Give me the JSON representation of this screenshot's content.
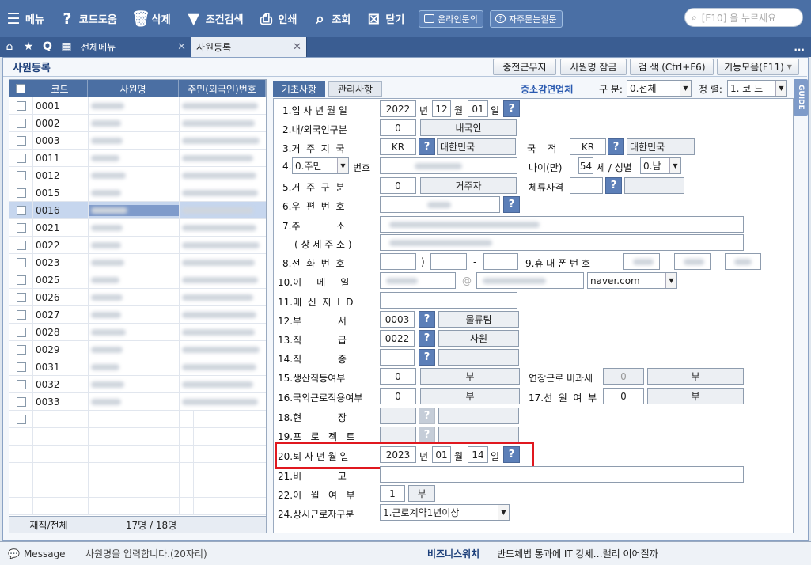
{
  "toolbar": {
    "menu": "메뉴",
    "code_help": "코드도움",
    "delete": "삭제",
    "cond_search": "조건검색",
    "print": "인쇄",
    "view": "조회",
    "close": "닫기",
    "online_inquiry": "온라인문의",
    "faq": "자주묻는질문",
    "search_placeholder": "[F10] 을 누르세요"
  },
  "tabs": {
    "all_menu": "전체메뉴",
    "employee_reg": "사원등록",
    "more": "..."
  },
  "page": {
    "title": "사원등록",
    "btn_resign": "중전근무지",
    "btn_lock": "사원명 잠금",
    "btn_search": "검  색 (Ctrl+F6)",
    "btn_functions": "기능모음(F11)"
  },
  "grid": {
    "headers": [
      "코드",
      "사원명",
      "주민(외국인)번호"
    ],
    "rows": [
      "0001",
      "0002",
      "0003",
      "0011",
      "0012",
      "0015",
      "0016",
      "0021",
      "0022",
      "0023",
      "0025",
      "0026",
      "0027",
      "0028",
      "0029",
      "0031",
      "0032",
      "0033"
    ],
    "selected_code": "0016",
    "footer_label": "재직/전체",
    "footer_value": "17명  /  18명"
  },
  "form_tabs": {
    "basic": "기초사항",
    "management": "관리사항",
    "company_type": "중소감면업체",
    "sort_label": "구 분:",
    "sort_value": "0.전체",
    "order_label": "정 렬:",
    "order_value": "1. 코  드"
  },
  "form": {
    "f1_label": "1.입 사 년 월 일",
    "f1_year": "2022",
    "f1_month": "12",
    "f1_day": "01",
    "unit_year": "년",
    "unit_month": "월",
    "unit_day": "일",
    "f2_label": "2.내/외국인구분",
    "f2_code": "0",
    "f2_value": "내국인",
    "f3_label": "3.거  주  지  국",
    "f3_code": "KR",
    "f3_value": "대한민국",
    "nation_label": "국    적",
    "nation_code": "KR",
    "nation_value": "대한민국",
    "f4_type": "0.주민",
    "f4_label": "번호",
    "age_label": "나이(만)",
    "age_value": "54",
    "age_unit": "세 / 성별",
    "gender_value": "0.남",
    "f5_label": "5.거  주  구  분",
    "f5_code": "0",
    "f5_value": "거주자",
    "visa_label": "체류자격",
    "f6_label": "6.우  편  번  호",
    "f7_label": "7.주            소",
    "f7b_label": "( 상 세 주 소 )",
    "f8_label": "8.전  화  번  호",
    "f8_sep1": ")",
    "f8_sep2": "-",
    "f9_label": "9.휴 대 폰 번 호",
    "f10_label": "10.이     메     일",
    "f10_at": "@",
    "f10_domain": "naver.com",
    "f11_label": "11.메  신  저  I  D",
    "f12_label": "12.부            서",
    "f12_code": "0003",
    "f12_value": "물류팀",
    "f13_label": "13.직            급",
    "f13_code": "0022",
    "f13_value": "사원",
    "f14_label": "14.직            종",
    "f15_label": "15.생산직등여부",
    "f15_code": "0",
    "f15_value": "부",
    "ot_label": "연장근로 비과세",
    "ot_code": "0",
    "ot_value": "부",
    "f16_label": "16.국외근로적용여부",
    "f16_code": "0",
    "f16_value": "부",
    "f17_label": "17.선  원  여  부",
    "f17_code": "0",
    "f17_value": "부",
    "f18_label": "18.현            장",
    "f19_label": "19.프   로   젝   트",
    "f20_label": "20.퇴 사 년 월 일",
    "f20_year": "2023",
    "f20_month": "01",
    "f20_day": "14",
    "f21_label": "21.비            고",
    "f22_label": "22.이   월   여   부",
    "f22_code": "1",
    "f22_value": "부",
    "f24_label": "24.상시근로자구분",
    "f24_value": "1.근로계약1년이상"
  },
  "message": {
    "label": "Message",
    "text": "사원명을 입력합니다.(20자리)",
    "news_label": "비즈니스워치",
    "news_text": "반도체법 통과에 IT 강세…랠리 이어질까"
  },
  "guide": "GUIDE"
}
